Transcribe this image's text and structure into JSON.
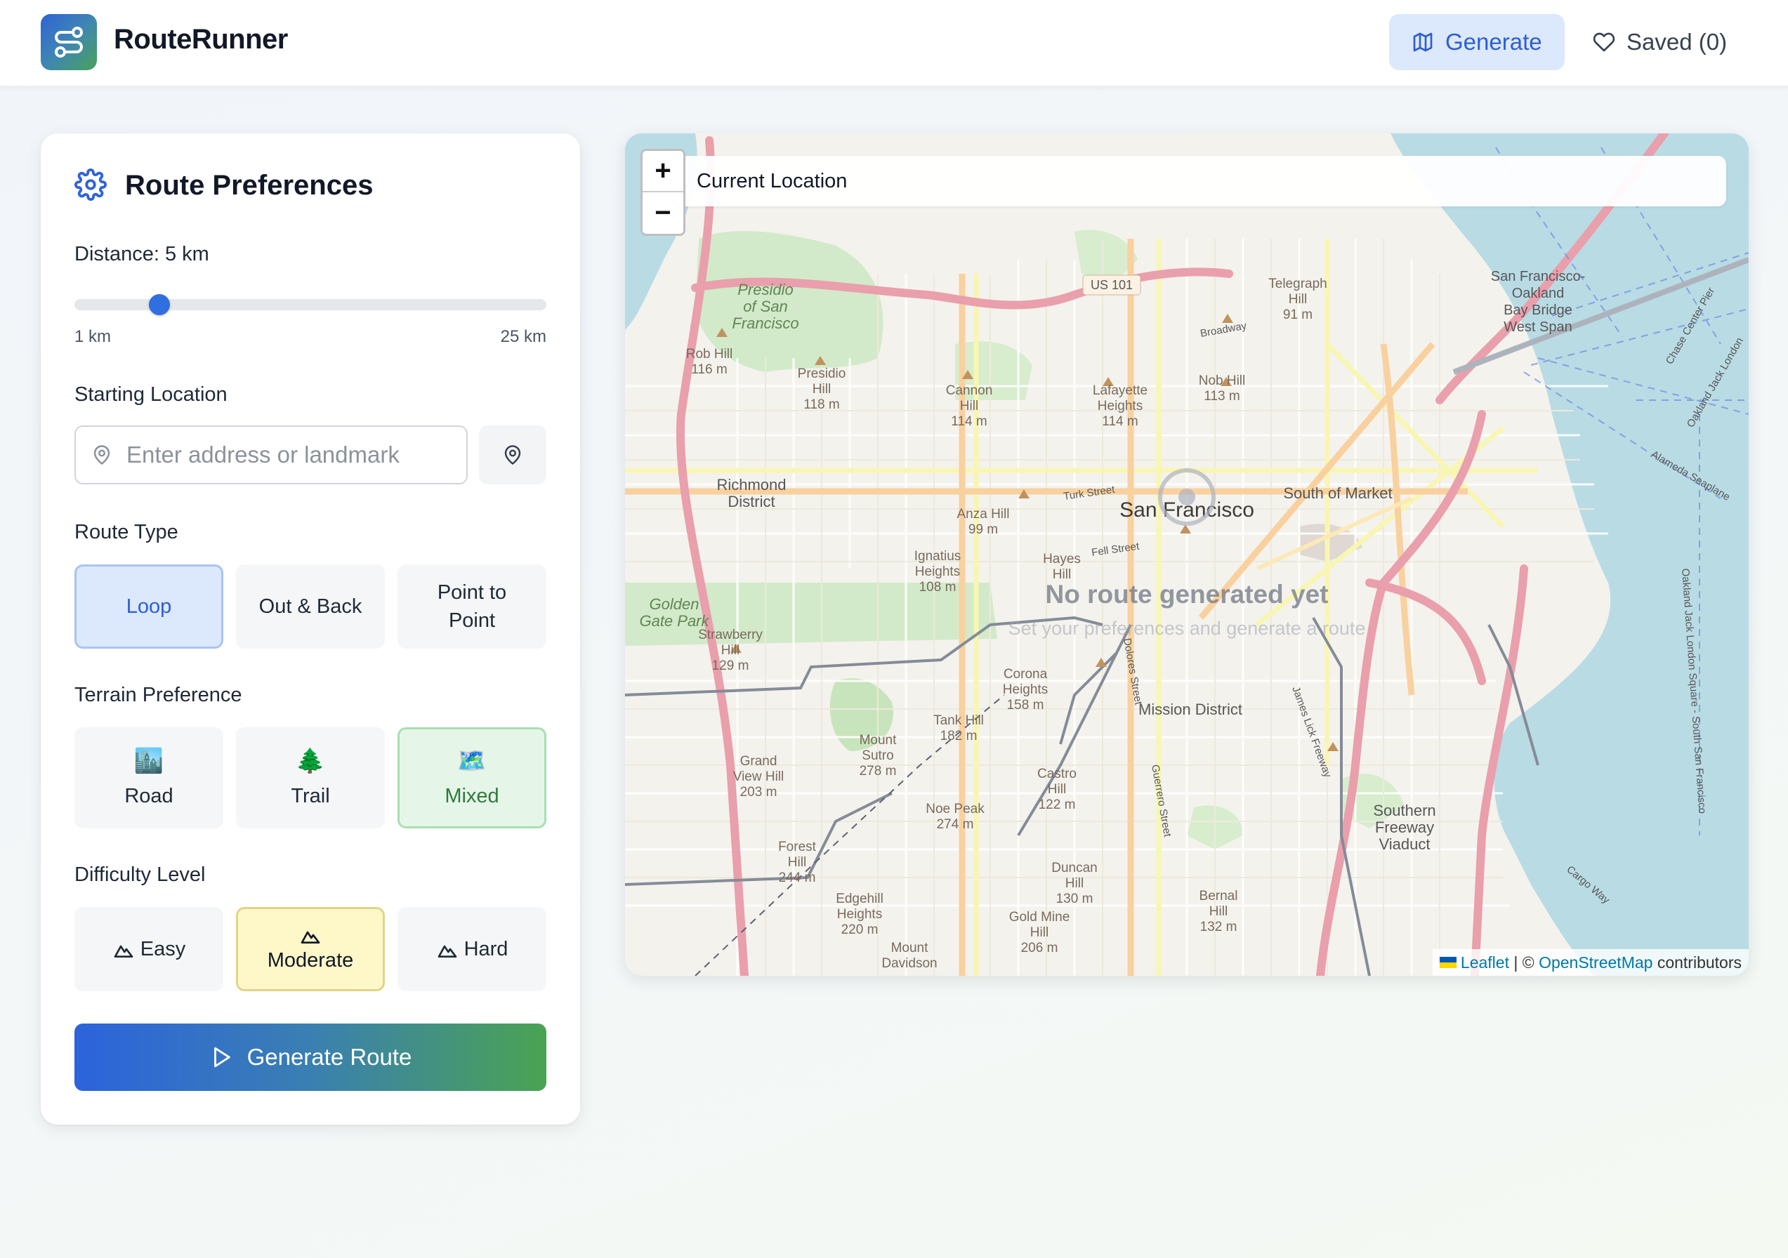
{
  "app": {
    "brand": "RouteRunner",
    "nav": {
      "generate": "Generate",
      "saved": "Saved (0)"
    }
  },
  "preferences": {
    "title": "Route Preferences",
    "distance_label": "Distance: 5 km",
    "distance": {
      "value_km": 5,
      "min_label": "1 km",
      "max_label": "25 km",
      "fill_fraction": 0.17
    },
    "starting_location": {
      "label": "Starting Location",
      "placeholder": "Enter address or landmark",
      "value": ""
    },
    "route_type": {
      "label": "Route Type",
      "options": [
        "Loop",
        "Out & Back",
        "Point to Point"
      ],
      "selected": "Loop"
    },
    "terrain": {
      "label": "Terrain Preference",
      "options": [
        {
          "label": "Road",
          "icon": "city-icon"
        },
        {
          "label": "Trail",
          "icon": "tree-icon"
        },
        {
          "label": "Mixed",
          "icon": "map-icon"
        }
      ],
      "selected": "Mixed"
    },
    "difficulty": {
      "label": "Difficulty Level",
      "options": [
        "Easy",
        "Moderate",
        "Hard"
      ],
      "selected": "Moderate"
    },
    "generate_button": "Generate Route"
  },
  "map": {
    "current_location": "Current Location",
    "zoom_in": "+",
    "zoom_out": "−",
    "empty_title": "No route generated yet",
    "empty_subtitle": "Set your preferences and generate a route",
    "attribution": {
      "leaflet": "Leaflet",
      "sep": " | © ",
      "osm": "OpenStreetMap",
      "suffix": " contributors"
    },
    "place_labels": [
      "Presidio of San Francisco",
      "Rob Hill 116 m",
      "Presidio Hill 118 m",
      "Cannon Hill 114 m",
      "Lafayette Heights 114 m",
      "Telegraph Hill 91 m",
      "Nob Hill 113 m",
      "US 101",
      "Broadway",
      "San Francisco-Oakland Bay Bridge West Span",
      "Richmond District",
      "Anza Hill 99 m",
      "Turk Street",
      "San Francisco",
      "South of Market",
      "Fell Street",
      "Ignatius Heights 108 m",
      "Hayes Hill",
      "Golden Gate Park",
      "Strawberry Hill 129 m",
      "Corona Heights 158 m",
      "Mission District",
      "Tank Hill 182 m",
      "Grand View Hill 203 m",
      "Mount Sutro 278 m",
      "Castro Hill 122 m",
      "Noe Peak 274 m",
      "Forest Hill 244 m",
      "Southern Freeway Viaduct",
      "Duncan Hill 130 m",
      "Bernal Hill 132 m",
      "Edgehill Heights 220 m",
      "Gold Mine Hill 206 m",
      "Mount Davidson",
      "Dolores Street",
      "Guerrero Street",
      "James Lick Freeway",
      "Oakland Jack London Square - South San Francisco",
      "Alameda Seaplane",
      "Cargo Way",
      "Chase Center Pier",
      "Oakland Jack London"
    ]
  }
}
